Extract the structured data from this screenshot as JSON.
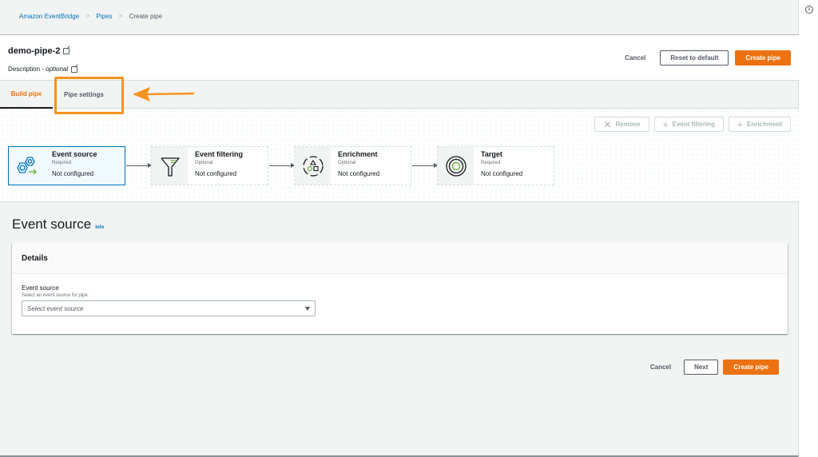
{
  "breadcrumbs": [
    {
      "label": "Amazon EventBridge"
    },
    {
      "label": "Pipes"
    },
    {
      "label": "Create pipe"
    }
  ],
  "header": {
    "pipe_name": "demo-pipe-2",
    "description_label": "Description - ",
    "description_optional": "optional",
    "cancel_label": "Cancel",
    "reset_label": "Reset to default",
    "create_label": "Create pipe"
  },
  "tabs": [
    {
      "label": "Build pipe",
      "active": true
    },
    {
      "label": "Pipe settings",
      "active": false
    }
  ],
  "canvas": {
    "actions": [
      {
        "label": "Remove",
        "icon": "close-icon",
        "glyph": "✕"
      },
      {
        "label": "Event filtering",
        "icon": "plus-icon",
        "glyph": "+"
      },
      {
        "label": "Enrichment",
        "icon": "plus-icon",
        "glyph": "+"
      }
    ],
    "nodes": [
      {
        "title": "Event source",
        "requirement": "Required",
        "status": "Not configured",
        "icon": "event-source-icon",
        "selected": true
      },
      {
        "title": "Event filtering",
        "requirement": "Optional",
        "status": "Not configured",
        "icon": "filter-funnel-icon",
        "selected": false
      },
      {
        "title": "Enrichment",
        "requirement": "Optional",
        "status": "Not configured",
        "icon": "enrichment-shapes-icon",
        "selected": false
      },
      {
        "title": "Target",
        "requirement": "Required",
        "status": "Not configured",
        "icon": "target-icon",
        "selected": false
      }
    ]
  },
  "section": {
    "title": "Event source",
    "info_label": "Info"
  },
  "details": {
    "title": "Details",
    "field_label": "Event source",
    "field_description": "Select an event source for pipe.",
    "select_placeholder": "Select event source"
  },
  "footer": {
    "cancel_label": "Cancel",
    "next_label": "Next",
    "create_label": "Create pipe"
  },
  "colors": {
    "accent_orange": "#ec7211",
    "link_blue": "#0073bb",
    "highlight_annotation": "#f7931e",
    "success_green": "#6aaf35"
  }
}
